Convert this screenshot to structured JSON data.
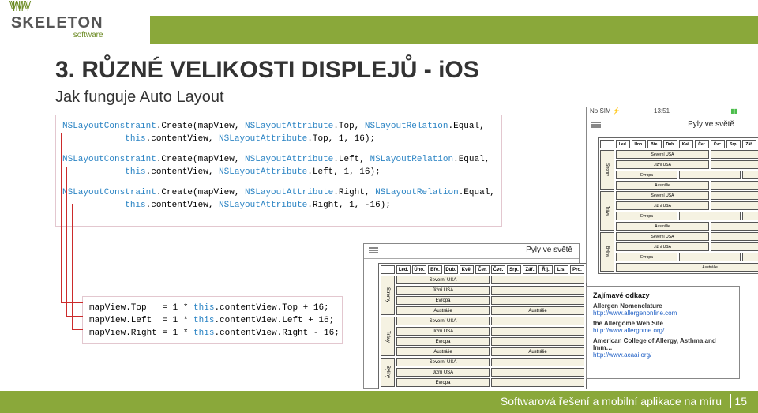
{
  "logo": {
    "main": "SKELETON",
    "sub": "software"
  },
  "slide": {
    "title": "3. RŮZNÉ VELIKOSTI DISPLEJŮ - iOS",
    "subtitle": "Jak funguje Auto Layout"
  },
  "code1": {
    "l1a": "NSLayoutConstraint",
    "l1b": ".Create(mapView, ",
    "l1c": "NSLayoutAttribute",
    "l1d": ".Top, ",
    "l1e": "NSLayoutRelation",
    "l1f": ".Equal,",
    "l2a": "            ",
    "l2b": "this",
    "l2c": ".contentView, ",
    "l2d": "NSLayoutAttribute",
    "l2e": ".Top, 1, 16);",
    "l3a": "NSLayoutConstraint",
    "l3b": ".Create(mapView, ",
    "l3c": "NSLayoutAttribute",
    "l3d": ".Left, ",
    "l3e": "NSLayoutRelation",
    "l3f": ".Equal,",
    "l4a": "            ",
    "l4b": "this",
    "l4c": ".contentView, ",
    "l4d": "NSLayoutAttribute",
    "l4e": ".Left, 1, 16);",
    "l5a": "NSLayoutConstraint",
    "l5b": ".Create(mapView, ",
    "l5c": "NSLayoutAttribute",
    "l5d": ".Right, ",
    "l5e": "NSLayoutRelation",
    "l5f": ".Equal,",
    "l6a": "            ",
    "l6b": "this",
    "l6c": ".contentView, ",
    "l6d": "NSLayoutAttribute",
    "l6e": ".Right, 1, -16);"
  },
  "code2": {
    "l1a": "mapView.Top   = 1 * ",
    "l1b": "this",
    "l1c": ".contentView.Top + 16;",
    "l2a": "mapView.Left  = 1 * ",
    "l2b": "this",
    "l2c": ".contentView.Left + 16;",
    "l3a": "mapView.Right = 1 * ",
    "l3b": "this",
    "l3c": ".contentView.Right - 16;"
  },
  "phone": {
    "title": "Pyly ve světě",
    "status_left": "No SIM ⚡",
    "status_time": "13:51",
    "headers": [
      "Led.",
      "Úno.",
      "Bře.",
      "Dub.",
      "Kvě.",
      "Čer.",
      "Čvc.",
      "Srp.",
      "Zář.",
      "Říj.",
      "Lis.",
      "Pro."
    ],
    "rows_side": [
      "Stromy",
      "Trávy",
      "Byliny"
    ],
    "rows": [
      "Severní USA",
      "Jižní USA",
      "Evropa",
      "Austrálie",
      "Severní USA",
      "Jižní USA",
      "Evropa",
      "Austrálie",
      "Severní USA",
      "Jižní USA",
      "Evropa"
    ]
  },
  "links": {
    "heading": "Zajímavé odkazy",
    "items": [
      {
        "t": "Allergen Nomenclature",
        "u": "http://www.allergenonline.com"
      },
      {
        "t": "the Allergome Web Site",
        "u": "http://www.allergome.org/"
      },
      {
        "t": "American College of Allergy, Asthma and Imm…",
        "u": "http://www.acaai.org/"
      }
    ]
  },
  "footer": {
    "text": "Softwarová řešení a mobilní aplikace na míru",
    "page": "15"
  }
}
